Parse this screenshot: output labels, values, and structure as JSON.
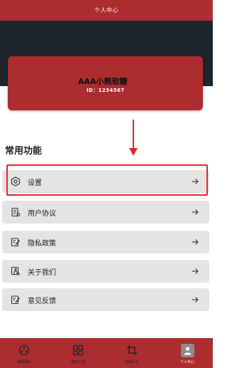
{
  "header": {
    "title": "个人中心"
  },
  "profile": {
    "name": "AAA小熊软糖",
    "id": "ID：1234567"
  },
  "section": {
    "title": "常用功能"
  },
  "menu": [
    {
      "label": "设置",
      "icon": "hexagon-settings-icon"
    },
    {
      "label": "用户协议",
      "icon": "agreement-icon"
    },
    {
      "label": "隐私政策",
      "icon": "privacy-edit-icon"
    },
    {
      "label": "关于我们",
      "icon": "about-icon"
    },
    {
      "label": "意见反馈",
      "icon": "feedback-edit-icon"
    }
  ],
  "tabs": [
    {
      "label": "眼睛保护",
      "icon": "eye-dial-icon"
    },
    {
      "label": "电影之窗",
      "icon": "grid-icon"
    },
    {
      "label": "剪辑片手",
      "icon": "crop-icon"
    },
    {
      "label": "个人中心",
      "icon": "profile-icon",
      "active": true
    }
  ],
  "colors": {
    "brand_red": "#ad2c2f",
    "dark_band": "#1c252d",
    "highlight": "#e0282c",
    "menu_bg": "#e4e4e4"
  }
}
